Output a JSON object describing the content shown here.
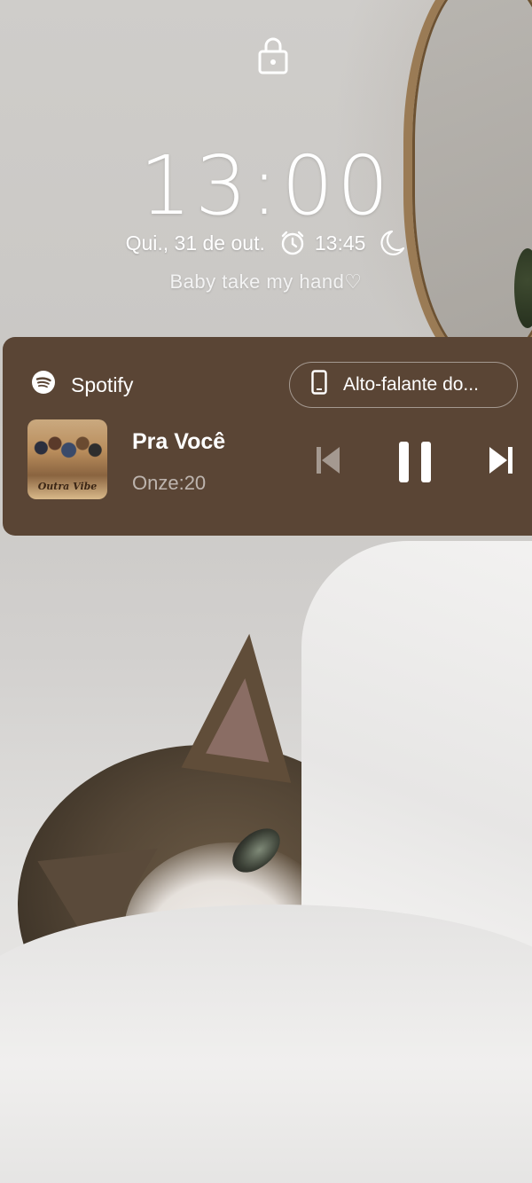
{
  "lockscreen": {
    "lock_icon": "lock-icon",
    "time": "13:00",
    "date": "Qui., 31 de out.",
    "alarm_icon": "alarm-clock-icon",
    "alarm_time": "13:45",
    "dnd_icon": "moon-icon",
    "owner_message": "Baby take my hand♡"
  },
  "media_card": {
    "background_color": "#5a4535",
    "app_icon": "spotify-icon",
    "app_name": "Spotify",
    "output_icon": "phone-speaker-icon",
    "output_label": "Alto-falante do...",
    "album_icon": "album-art",
    "album_art_text": "Outra Vibe",
    "track_title": "Pra Você",
    "track_artist": "Onze:20",
    "controls": {
      "previous_icon": "skip-previous-icon",
      "pause_icon": "pause-icon",
      "next_icon": "skip-next-icon"
    }
  }
}
